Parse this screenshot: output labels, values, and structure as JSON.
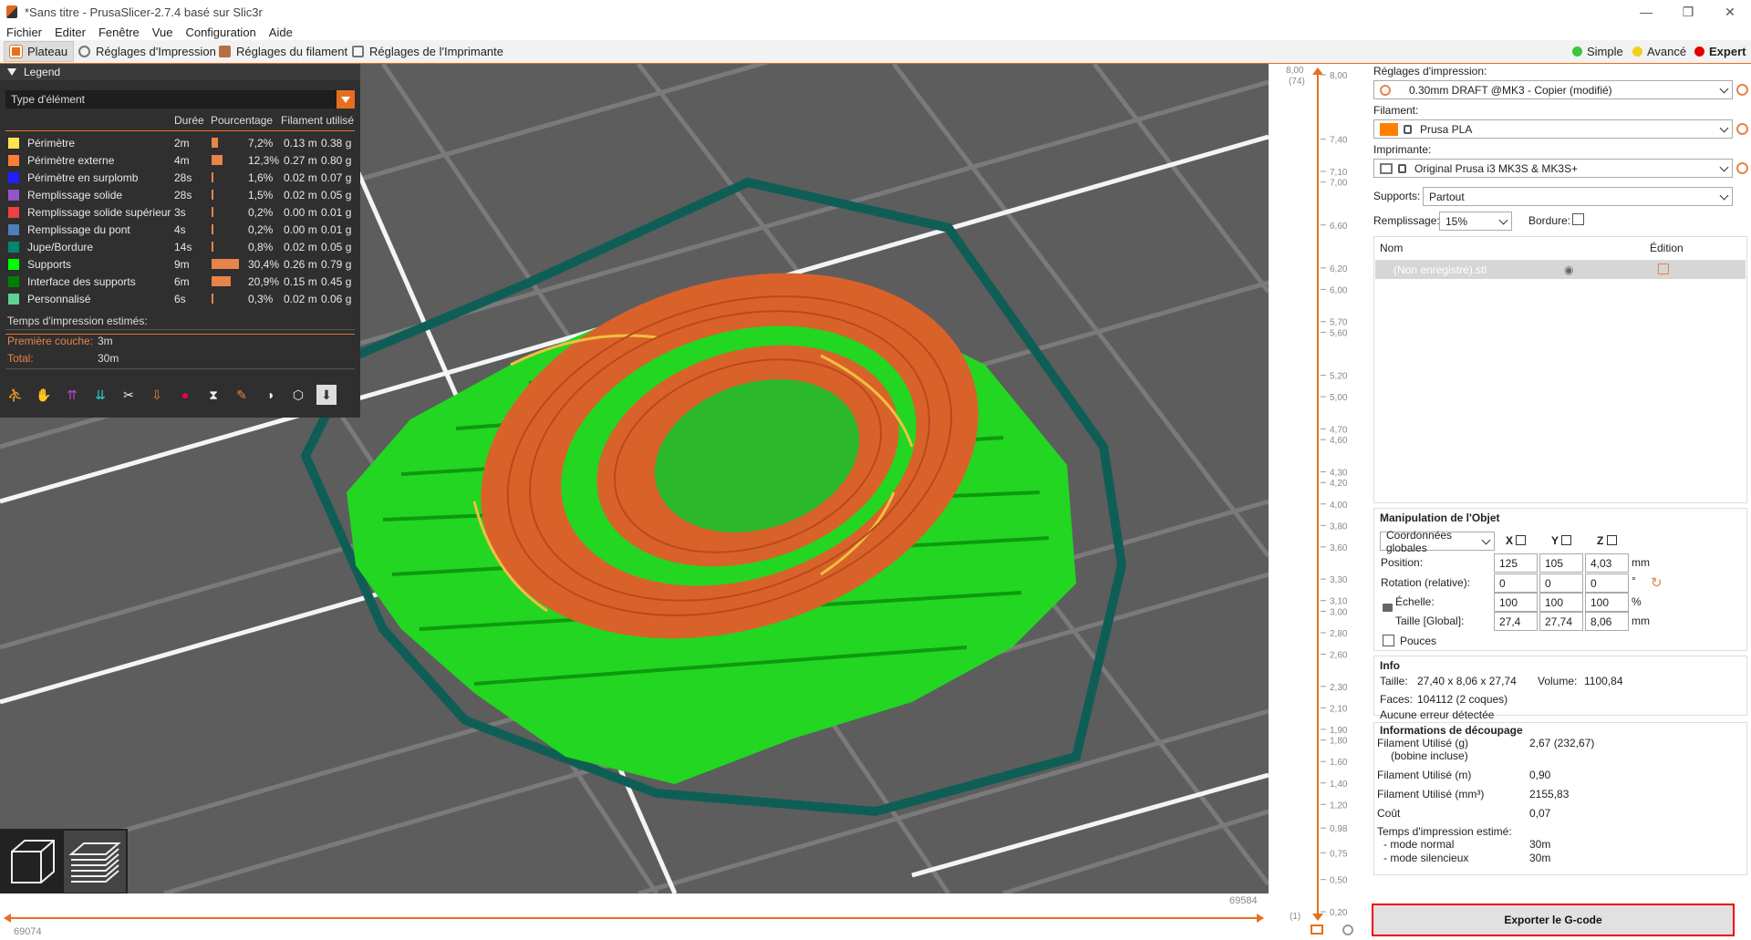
{
  "window": {
    "title": "*Sans titre - PrusaSlicer-2.7.4 basé sur Slic3r",
    "minimize": "—",
    "maximize": "❐",
    "close": "✕"
  },
  "menu": [
    "Fichier",
    "Editer",
    "Fenêtre",
    "Vue",
    "Configuration",
    "Aide"
  ],
  "tabs": [
    "Plateau",
    "Réglages d'Impression",
    "Réglages du filament",
    "Réglages de l'Imprimante"
  ],
  "modes": [
    {
      "label": "Simple",
      "color": "#3cc63c"
    },
    {
      "label": "Avancé",
      "color": "#f2d01b"
    },
    {
      "label": "Expert",
      "color": "#e00000"
    }
  ],
  "legend": {
    "title": "Legend",
    "view_type": "Type d'élément",
    "columns": {
      "duration": "Durée",
      "percent": "Pourcentage",
      "filament": "Filament utilisé"
    },
    "rows": [
      {
        "name": "Périmètre",
        "color": "#ffe64d",
        "time": "2m",
        "pct": "7,2%",
        "pct_value": 7.2,
        "len": "0.13 m",
        "weight": "0.38 g"
      },
      {
        "name": "Périmètre externe",
        "color": "#ff7d38",
        "time": "4m",
        "pct": "12,3%",
        "pct_value": 12.3,
        "len": "0.27 m",
        "weight": "0.80 g"
      },
      {
        "name": "Périmètre en surplomb",
        "color": "#1f1fff",
        "time": "28s",
        "pct": "1,6%",
        "pct_value": 1.6,
        "len": "0.02 m",
        "weight": "0.07 g"
      },
      {
        "name": "Remplissage solide",
        "color": "#9654cc",
        "time": "28s",
        "pct": "1,5%",
        "pct_value": 1.5,
        "len": "0.02 m",
        "weight": "0.05 g"
      },
      {
        "name": "Remplissage solide supérieur",
        "color": "#f04040",
        "time": "3s",
        "pct": "0,2%",
        "pct_value": 0.2,
        "len": "0.00 m",
        "weight": "0.01 g"
      },
      {
        "name": "Remplissage du pont",
        "color": "#4d80ba",
        "time": "4s",
        "pct": "0,2%",
        "pct_value": 0.2,
        "len": "0.00 m",
        "weight": "0.01 g"
      },
      {
        "name": "Jupe/Bordure",
        "color": "#00876e",
        "time": "14s",
        "pct": "0,8%",
        "pct_value": 0.8,
        "len": "0.02 m",
        "weight": "0.05 g"
      },
      {
        "name": "Supports",
        "color": "#00ff00",
        "time": "9m",
        "pct": "30,4%",
        "pct_value": 30.4,
        "len": "0.26 m",
        "weight": "0.79 g"
      },
      {
        "name": "Interface des supports",
        "color": "#008000",
        "time": "6m",
        "pct": "20,9%",
        "pct_value": 20.9,
        "len": "0.15 m",
        "weight": "0.45 g"
      },
      {
        "name": "Personnalisé",
        "color": "#5ed194",
        "time": "6s",
        "pct": "0,3%",
        "pct_value": 0.3,
        "len": "0.02 m",
        "weight": "0.06 g"
      }
    ],
    "estimate_title": "Temps d'impression estimés:",
    "first_layer_label": "Première couche:",
    "first_layer_value": "3m",
    "total_label": "Total:",
    "total_value": "30m"
  },
  "hslider": {
    "left_value": "69074",
    "right_value": "69584"
  },
  "vslider": {
    "top_value": "8,00",
    "top_layer": "(74)",
    "bottom_value": "0,20",
    "bottom_layer": "(1)",
    "ticks": [
      "8,00",
      "7,40",
      "7,10",
      "7,00",
      "6,60",
      "6,20",
      "6,00",
      "5,70",
      "5,60",
      "5,20",
      "5,00",
      "4,70",
      "4,60",
      "4,30",
      "4,20",
      "4,00",
      "3,80",
      "3,60",
      "3,30",
      "3,10",
      "3,00",
      "2,80",
      "2,60",
      "2,30",
      "2,10",
      "1,90",
      "1,80",
      "1,60",
      "1,40",
      "1,20",
      "0,98",
      "0,75",
      "0,50",
      "0,20"
    ],
    "tick_values": [
      8.0,
      7.4,
      7.1,
      7.0,
      6.6,
      6.2,
      6.0,
      5.7,
      5.6,
      5.2,
      5.0,
      4.7,
      4.6,
      4.3,
      4.2,
      4.0,
      3.8,
      3.6,
      3.3,
      3.1,
      3.0,
      2.8,
      2.6,
      2.3,
      2.1,
      1.9,
      1.8,
      1.6,
      1.4,
      1.2,
      0.98,
      0.75,
      0.5,
      0.2
    ]
  },
  "right_panel": {
    "print_settings_label": "Réglages d'impression:",
    "print_settings_value": "0.30mm DRAFT @MK3 - Copier (modifié)",
    "filament_label": "Filament:",
    "filament_value": "Prusa PLA",
    "filament_color": "#ff8000",
    "printer_label": "Imprimante:",
    "printer_value": "Original Prusa i3 MK3S & MK3S+",
    "supports_label": "Supports:",
    "supports_value": "Partout",
    "infill_label": "Remplissage:",
    "infill_value": "15%",
    "brim_label": "Bordure:",
    "object_list": {
      "col_name": "Nom",
      "col_edit": "Édition",
      "item": "(Non enregistré).stl"
    },
    "manip": {
      "title": "Manipulation de l'Objet",
      "coords": "Coordonnées globales",
      "x": "X",
      "y": "Y",
      "z": "Z",
      "position_label": "Position:",
      "position": [
        "125",
        "105",
        "4,03"
      ],
      "position_unit": "mm",
      "rotation_label": "Rotation (relative):",
      "rotation": [
        "0",
        "0",
        "0"
      ],
      "rotation_unit": "°",
      "scale_label": "Échelle:",
      "scale": [
        "100",
        "100",
        "100"
      ],
      "scale_unit": "%",
      "size_label": "Taille [Global]:",
      "size": [
        "27,4",
        "27,74",
        "8,06"
      ],
      "size_unit": "mm",
      "inches_label": "Pouces"
    },
    "info": {
      "title": "Info",
      "size_label": "Taille:",
      "size_value": "27,40 x 8,06 x 27,74",
      "volume_label": "Volume:",
      "volume_value": "1100,84",
      "faces_label": "Faces:",
      "faces_value": "104112 (2 coques)",
      "errors": "Aucune erreur détectée"
    },
    "slice_info": {
      "title": "Informations de découpage",
      "fil_g_label": "Filament Utilisé (g)",
      "fil_g_sub": "(bobine incluse)",
      "fil_g_value": "2,67 (232,67)",
      "fil_m_label": "Filament Utilisé (m)",
      "fil_m_value": "0,90",
      "fil_mm3_label": "Filament Utilisé (mm³)",
      "fil_mm3_value": "2155,83",
      "cost_label": "Coût",
      "cost_value": "0,07",
      "time_label": "Temps d'impression estimé:",
      "normal_label": "- mode normal",
      "normal_value": "30m",
      "silent_label": "- mode silencieux",
      "silent_value": "30m"
    },
    "export_button": "Exporter le G-code"
  }
}
